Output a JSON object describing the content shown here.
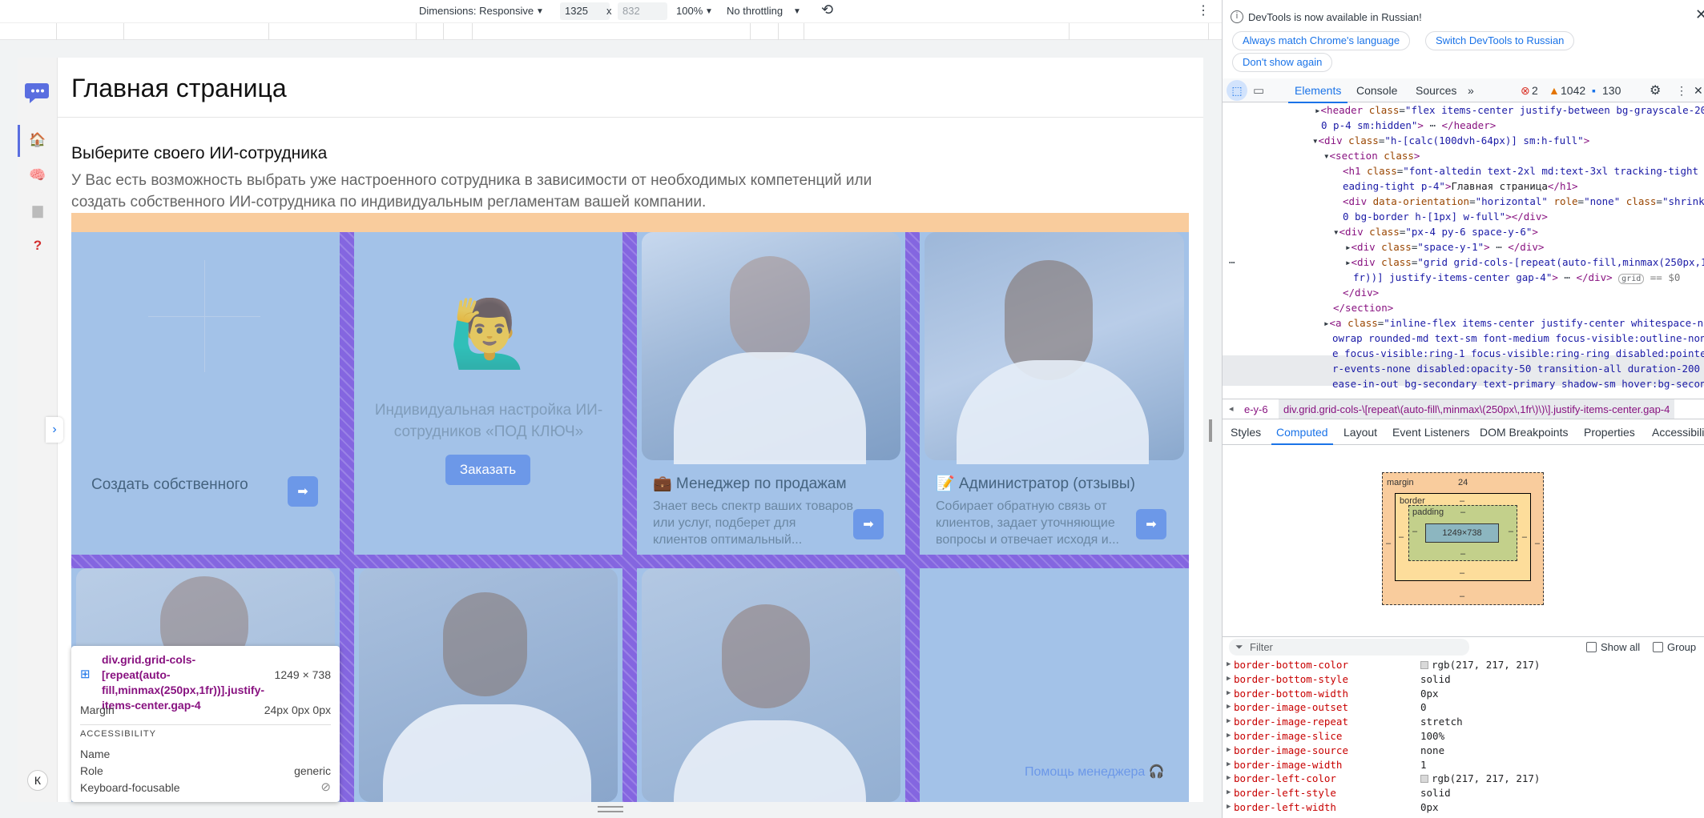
{
  "device_toolbar": {
    "dimensions_label": "Dimensions: Responsive",
    "width_value": "1325",
    "x_sep": "x",
    "height_placeholder": "832",
    "zoom": "100%",
    "throttling": "No throttling"
  },
  "page": {
    "title": "Главная страница",
    "section_title": "Выберите своего ИИ-сотрудника",
    "section_desc": "У Вас есть возможность выбрать уже настроенного сотрудника в зависимости от необходимых компетенций или создать собственного ИИ-сотрудника по индивидуальным регламентам вашей компании.",
    "cards": [
      {
        "title": "Создать собственного"
      },
      {
        "title": "Индивидуальная настройка ИИ-сотрудников «ПОД КЛЮЧ»",
        "button": "Заказать",
        "emoji": "🙋‍♂️"
      },
      {
        "title": "💼 Менеджер по продажам",
        "desc": "Знает весь спектр ваших товаров или услуг, подберет для клиентов оптимальный..."
      },
      {
        "title": "📝 Администратор (отзывы)",
        "desc": "Собирает обратную связь от клиентов, задает уточняющие вопросы и отвечает исходя и..."
      }
    ],
    "help_link": "Помощь менеджера 🎧",
    "avatar_letter": "К"
  },
  "tooltip": {
    "selector": "div.grid.grid-cols-[repeat(auto-fill,minmax(250px,1fr))].justify-items-center.gap-4",
    "size": "1249 × 738",
    "margin_label": "Margin",
    "margin_value": "24px 0px 0px",
    "section": "ACCESSIBILITY",
    "name_label": "Name",
    "role_label": "Role",
    "role_value": "generic",
    "focus_label": "Keyboard-focusable"
  },
  "devtools": {
    "notice": "DevTools is now available in Russian!",
    "btn_match": "Always match Chrome's language",
    "btn_switch": "Switch DevTools to Russian",
    "btn_dont": "Don't show again",
    "tabs": [
      "Elements",
      "Console",
      "Sources"
    ],
    "err_count": "2",
    "warn_count": "1042",
    "info_count": "130",
    "breadcrumb_left": "e-y-6",
    "breadcrumb": "div.grid.grid-cols-\\[repeat\\(auto-fill\\,minmax\\(250px\\,1fr\\)\\)\\].justify-items-center.gap-4",
    "sub_tabs": [
      "Styles",
      "Computed",
      "Layout",
      "Event Listeners",
      "DOM Breakpoints",
      "Properties",
      "Accessibility"
    ],
    "box": {
      "margin_label": "margin",
      "margin_top": "24",
      "border_label": "border",
      "padding_label": "padding",
      "dash": "–",
      "content": "1249×738"
    },
    "filter_placeholder": "Filter",
    "show_all": "Show all",
    "group": "Group",
    "properties": [
      {
        "name": "border-bottom-color",
        "value": "rgb(217, 217, 217)",
        "swatch": true
      },
      {
        "name": "border-bottom-style",
        "value": "solid"
      },
      {
        "name": "border-bottom-width",
        "value": "0px"
      },
      {
        "name": "border-image-outset",
        "value": "0"
      },
      {
        "name": "border-image-repeat",
        "value": "stretch"
      },
      {
        "name": "border-image-slice",
        "value": "100%"
      },
      {
        "name": "border-image-source",
        "value": "none"
      },
      {
        "name": "border-image-width",
        "value": "1"
      },
      {
        "name": "border-left-color",
        "value": "rgb(217, 217, 217)",
        "swatch": true
      },
      {
        "name": "border-left-style",
        "value": "solid"
      },
      {
        "name": "border-left-width",
        "value": "0px"
      }
    ]
  }
}
